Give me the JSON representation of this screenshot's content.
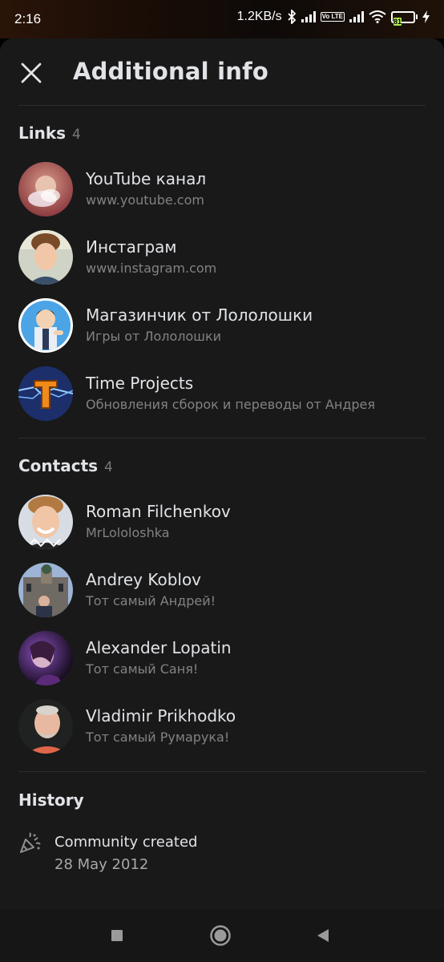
{
  "status_bar": {
    "time": "2:16",
    "net_speed": "1.2KB/s",
    "volte": "Vo LTE",
    "battery": "81",
    "icons": [
      "bluetooth-icon",
      "signal-icon",
      "volte-icon",
      "signal-icon",
      "wifi-icon",
      "battery-icon",
      "charging-icon"
    ]
  },
  "header": {
    "title": "Additional info",
    "close_icon": "close-icon"
  },
  "links": {
    "title": "Links",
    "count": "4",
    "items": [
      {
        "title": "YouTube канал",
        "subtitle": "www.youtube.com"
      },
      {
        "title": "Инстаграм",
        "subtitle": "www.instagram.com"
      },
      {
        "title": "Магазинчик от Лололошки",
        "subtitle": "Игры от Лололошки"
      },
      {
        "title": "Time Projects",
        "subtitle": "Обновления сборок и переводы от Андрея"
      }
    ]
  },
  "contacts": {
    "title": "Contacts",
    "count": "4",
    "items": [
      {
        "name": "Roman Filchenkov",
        "subtitle": "MrLololoshka"
      },
      {
        "name": "Andrey Koblov",
        "subtitle": "Тот самый Андрей!"
      },
      {
        "name": "Alexander Lopatin",
        "subtitle": "Тот самый Саня!"
      },
      {
        "name": "Vladimir Prikhodko",
        "subtitle": "Тот самый Румарука!"
      }
    ]
  },
  "history": {
    "title": "History",
    "items": [
      {
        "icon": "party-popper-icon",
        "label": "Community created",
        "date": "28 May 2012"
      }
    ]
  },
  "nav_bar": {
    "buttons": [
      "recents-square-icon",
      "home-circle-icon",
      "back-triangle-icon"
    ]
  },
  "colors": {
    "sheet_bg": "#19191a",
    "text_primary": "#e1e3e6",
    "text_secondary": "#828282",
    "divider": "#2c2d2e",
    "battery": "#b4ec51"
  }
}
